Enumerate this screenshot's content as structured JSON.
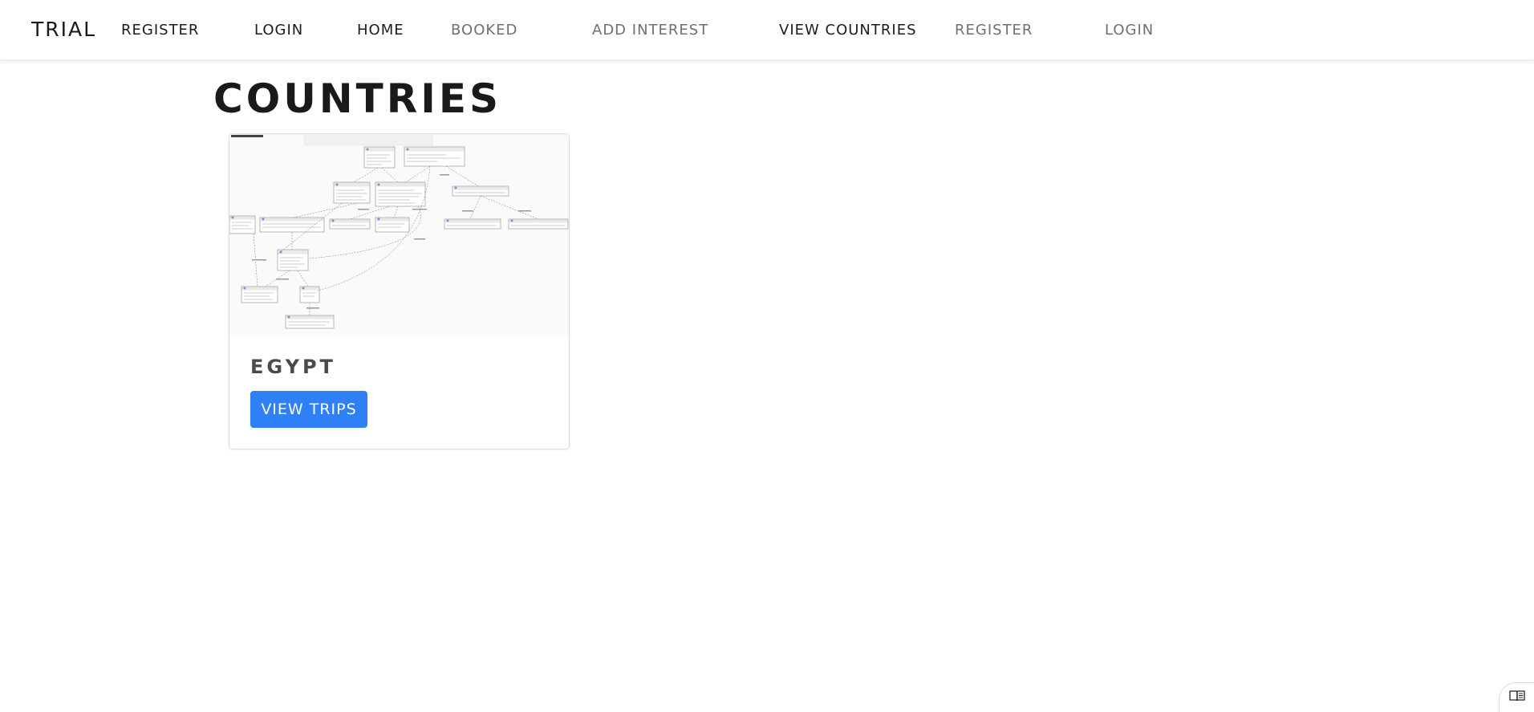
{
  "navbar": {
    "brand": "TRIAL",
    "links": [
      {
        "label": "REGISTER"
      },
      {
        "label": "LOGIN"
      },
      {
        "label": "HOME"
      },
      {
        "label": "BOOKED"
      },
      {
        "label": "ADD INTEREST"
      },
      {
        "label": "VIEW COUNTRIES"
      },
      {
        "label": "REGISTER"
      },
      {
        "label": "LOGIN"
      }
    ]
  },
  "page": {
    "title": "COUNTRIES"
  },
  "countries": [
    {
      "name": "EGYPT",
      "button_label": "VIEW TRIPS"
    }
  ],
  "theme": {
    "primary": "#2f80f7",
    "nav_dark": "#1c1c1c",
    "nav_muted": "#707070"
  },
  "icons": {
    "floating_button": "reader-book-icon"
  }
}
